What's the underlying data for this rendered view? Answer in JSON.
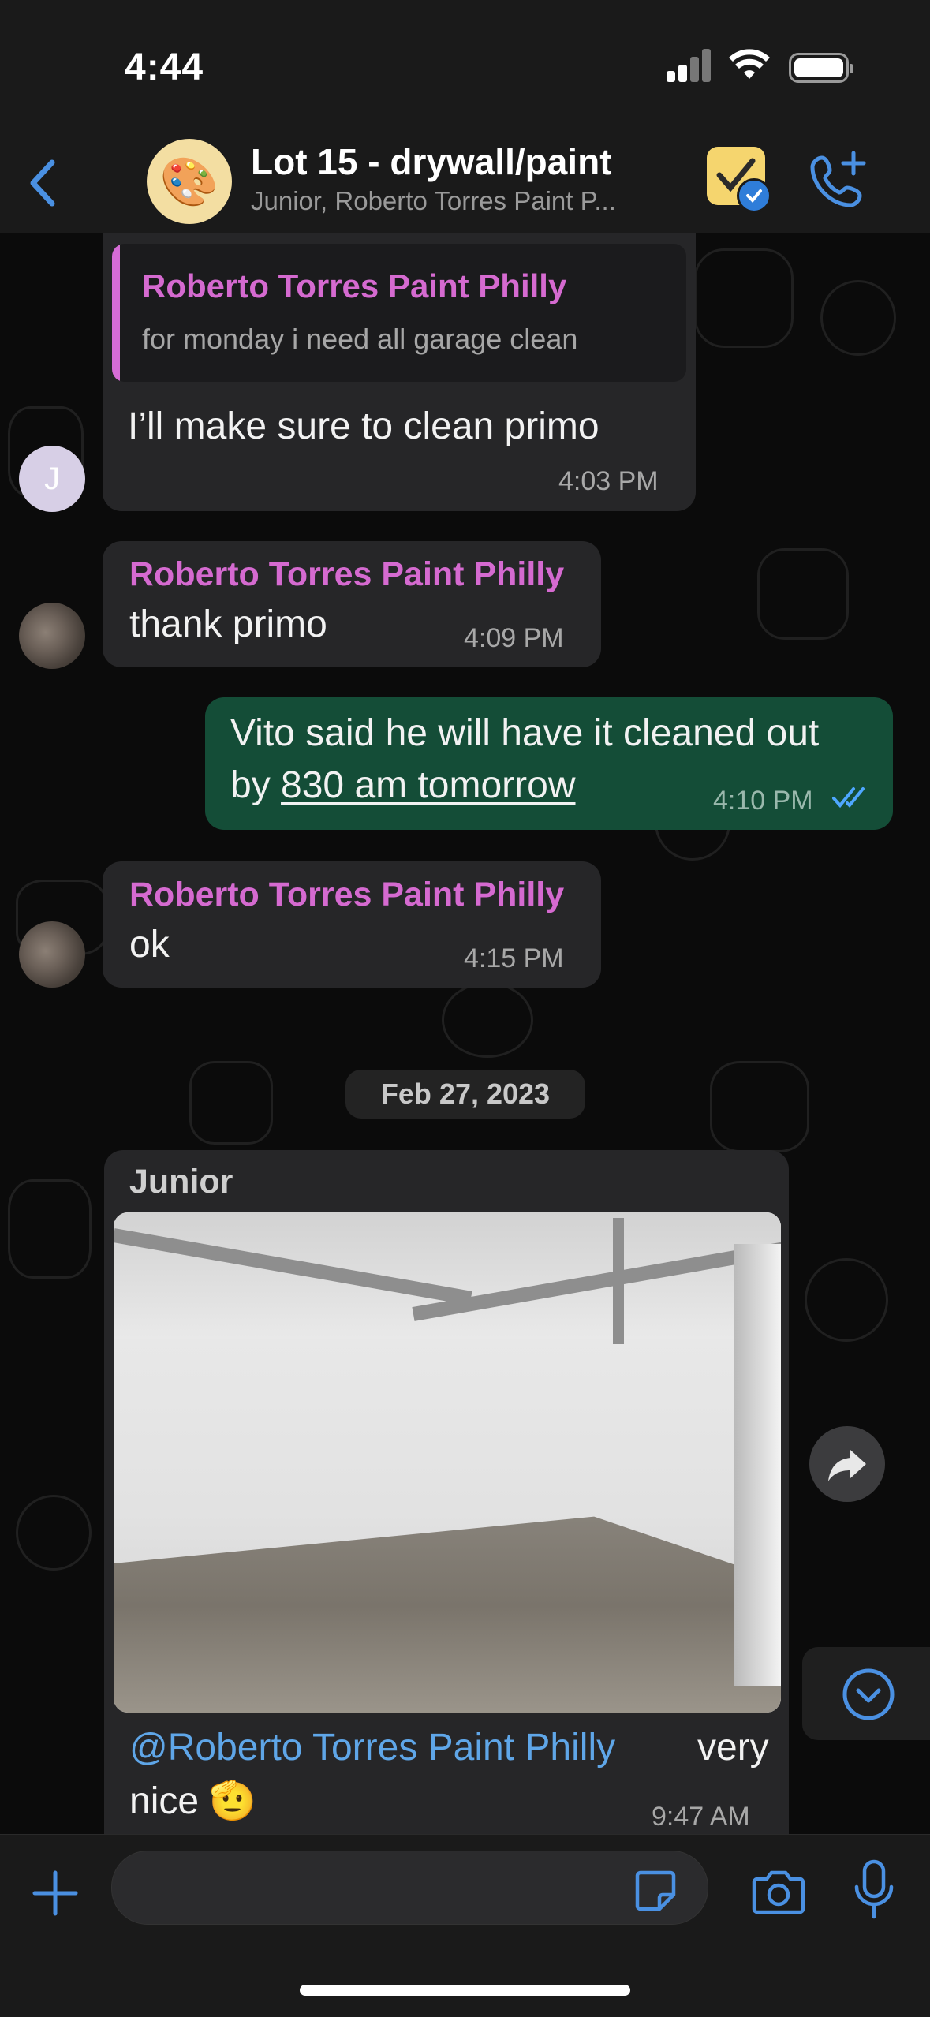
{
  "status_bar": {
    "time": "4:44"
  },
  "header": {
    "title": "Lot 15 - drywall/paint",
    "subtitle": "Junior, Roberto Torres Paint P...",
    "avatar_emoji": "🎨",
    "icons": [
      "back-chevron-icon",
      "verified-badge-icon",
      "add-call-icon"
    ]
  },
  "messages": {
    "m1": {
      "quote_name": "Roberto Torres Paint Philly",
      "quote_text": "for monday i need all garage clean",
      "text": "I’ll make sure to clean primo",
      "time": "4:03 PM",
      "avatar_initial": "J"
    },
    "m2": {
      "sender": "Roberto Torres Paint Philly",
      "text": "thank primo",
      "time": "4:09 PM"
    },
    "m3": {
      "line1": "Vito said he will have it cleaned out",
      "line2": "by ",
      "link": "830 am tomorrow",
      "time": "4:10 PM",
      "read_status": "read"
    },
    "m4": {
      "sender": "Roberto Torres Paint Philly",
      "text": "ok",
      "time": "4:15 PM"
    },
    "date_separator": "Feb 27, 2023",
    "m5": {
      "sender": "Junior",
      "mention": "@Roberto Torres Paint Philly",
      "text_after": "very",
      "line2": "nice 🫡",
      "time": "9:47 AM",
      "image": "garage-photo"
    }
  },
  "colors": {
    "background": "#0b0b0b",
    "incoming_bubble": "#262628",
    "outgoing_bubble": "#144d37",
    "sender_name": "#d56ad0",
    "accent": "#4a90e2"
  }
}
